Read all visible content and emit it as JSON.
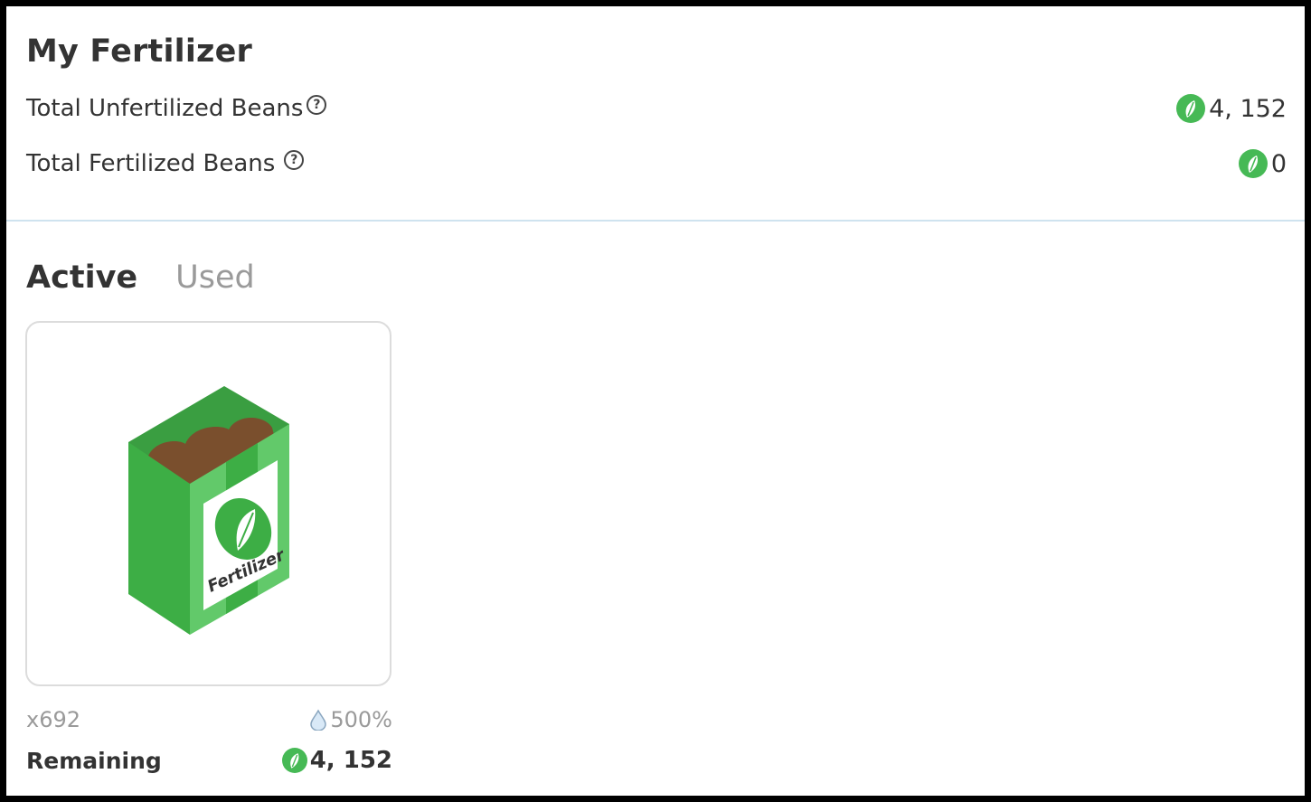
{
  "summary": {
    "title": "My Fertilizer",
    "unfertilized_label": "Total Unfertilized Beans",
    "unfertilized_value": "4, 152",
    "fertilized_label": "Total Fertilized Beans",
    "fertilized_value": "0",
    "help_glyph": "?"
  },
  "tabs": {
    "active_label": "Active",
    "used_label": "Used",
    "selected": "Active"
  },
  "fertilizer_card": {
    "bag_label": "Fertilizer",
    "quantity": "x692",
    "boost": "500%",
    "remaining_label": "Remaining",
    "remaining_value": "4, 152"
  },
  "colors": {
    "bean_green": "#46b955",
    "bag_green": "#3dae45",
    "soil_brown": "#7a4f2d",
    "divider": "#cfe3ef"
  },
  "icons": [
    "bean-icon",
    "help-icon",
    "water-drop-icon",
    "fertilizer-bag-icon"
  ]
}
